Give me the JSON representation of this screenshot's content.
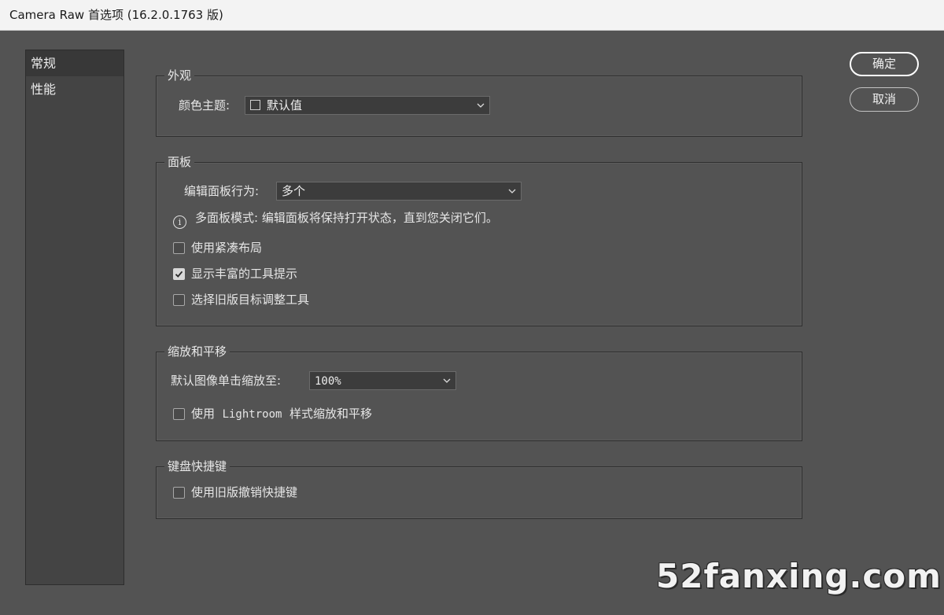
{
  "window": {
    "title": "Camera Raw 首选项  (16.2.0.1763 版)"
  },
  "sidebar": {
    "items": [
      {
        "label": "常规",
        "selected": true
      },
      {
        "label": "性能",
        "selected": false
      }
    ]
  },
  "appearance": {
    "legend": "外观",
    "color_theme_label": "颜色主题:",
    "color_theme_value": "默认值"
  },
  "panels": {
    "legend": "面板",
    "edit_panel_behavior_label": "编辑面板行为:",
    "edit_panel_behavior_value": "多个",
    "info_text": "多面板模式: 编辑面板将保持打开状态，直到您关闭它们。",
    "compact_layout_label": "使用紧凑布局",
    "compact_layout_checked": false,
    "rich_tooltips_label": "显示丰富的工具提示",
    "rich_tooltips_checked": true,
    "legacy_target_adjust_label": "选择旧版目标调整工具",
    "legacy_target_adjust_checked": false
  },
  "zoom_pan": {
    "legend": "缩放和平移",
    "default_zoom_label": "默认图像单击缩放至:",
    "default_zoom_value": "100%",
    "lightroom_style_prefix": "使用",
    "lightroom_style_brand": "Lightroom",
    "lightroom_style_suffix": "样式缩放和平移",
    "lightroom_style_checked": false
  },
  "keyboard": {
    "legend": "键盘快捷键",
    "legacy_undo_label": "使用旧版撤销快捷键",
    "legacy_undo_checked": false
  },
  "buttons": {
    "ok": "确定",
    "cancel": "取消"
  },
  "watermark": "52fanxing.com",
  "colors": {
    "background": "#535353",
    "sidebar": "#444444",
    "titlebar": "#f3f3f3"
  }
}
